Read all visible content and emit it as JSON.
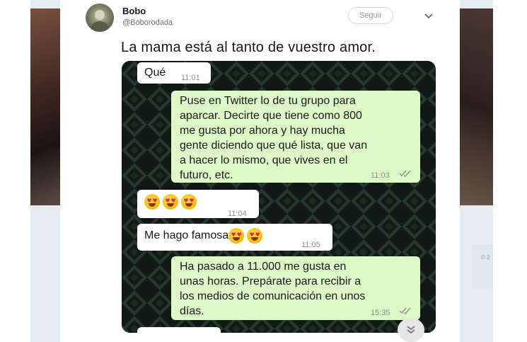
{
  "tweet": {
    "display_name": "Bobo",
    "handle": "@Boborodada",
    "follow_label": "Seguir",
    "text": "La mama está al tanto de vuestro amor."
  },
  "chat": {
    "messages": [
      {
        "dir": "in",
        "text": "Qué",
        "time": "11:01"
      },
      {
        "dir": "out",
        "lines": [
          "Puse en Twitter lo de tu grupo para",
          "aparcar. Decirte que tiene como 800",
          "me gusta por ahora y hay mucha",
          "gente diciendo que qué lista, que van",
          "a hacer lo mismo, que vives en el",
          "futuro, etc."
        ],
        "time": "11:03"
      },
      {
        "dir": "in",
        "text": "",
        "emojis": [
          "heart-eyes",
          "heart-eyes",
          "heart-eyes"
        ],
        "time": "11:04"
      },
      {
        "dir": "in",
        "text": "Me hago famosa",
        "emojis": [
          "heart-eyes",
          "heart-eyes"
        ],
        "time": "11:05"
      },
      {
        "dir": "out",
        "lines": [
          "Ha pasado a 11.000 me gusta en",
          "unas horas. Prepárate para recibir a",
          "los medios de comunicación en unos",
          "días."
        ],
        "time": "15:35"
      }
    ]
  },
  "footer": {
    "copyright": "© 2"
  }
}
